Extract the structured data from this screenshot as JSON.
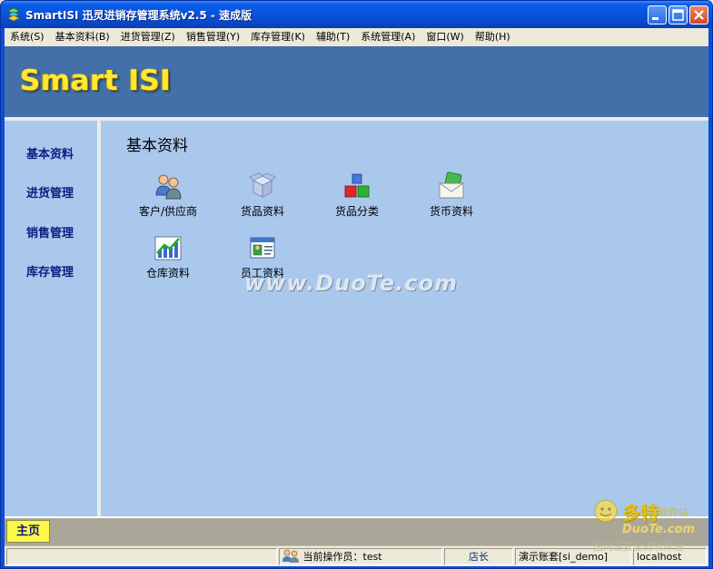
{
  "window": {
    "title": "SmartISI 迅灵进销存管理系统v2.5 - 速成版"
  },
  "menu": [
    "系统(S)",
    "基本资料(B)",
    "进货管理(Z)",
    "销售管理(Y)",
    "库存管理(K)",
    "辅助(T)",
    "系统管理(A)",
    "窗口(W)",
    "帮助(H)"
  ],
  "banner": {
    "brand": "Smart ISI"
  },
  "sidebar": {
    "items": [
      "基本资料",
      "进货管理",
      "销售管理",
      "库存管理"
    ]
  },
  "main": {
    "title": "基本资料",
    "tiles": [
      {
        "label": "客户/供应商",
        "icon": "customers-icon"
      },
      {
        "label": "货品资料",
        "icon": "goods-box-icon"
      },
      {
        "label": "货品分类",
        "icon": "category-cubes-icon"
      },
      {
        "label": "货币资料",
        "icon": "currency-envelope-icon"
      },
      {
        "label": "仓库资料",
        "icon": "warehouse-chart-icon"
      },
      {
        "label": "员工资料",
        "icon": "employee-card-icon"
      }
    ],
    "watermark": "www.DuoTe.com"
  },
  "tabs": {
    "home": "主页"
  },
  "status": {
    "operator": "当前操作员：test",
    "role": "店长",
    "account": "演示账套[si_demo]",
    "server": "localhost"
  },
  "corner_logo": {
    "line1": "多特",
    "line2": "软件站",
    "line3": "DuoTe.com",
    "line4": "国内最安全的软件站"
  },
  "colors": {
    "titlebar": "#0a52dc",
    "banner": "#4370a8",
    "panel": "#a9c8ec",
    "brand_text": "#ffe830",
    "home_tab": "#fff84a"
  }
}
